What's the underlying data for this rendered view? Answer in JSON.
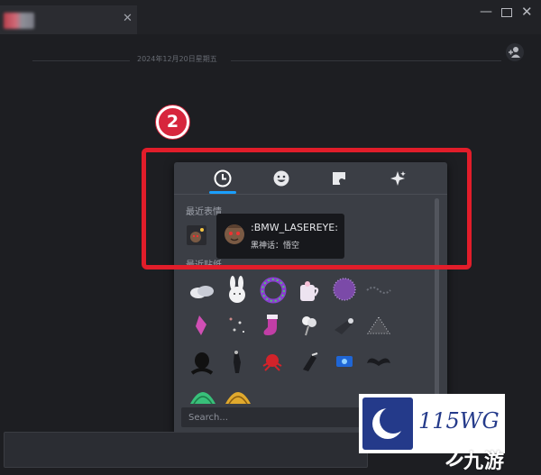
{
  "titlebar": {
    "tab_close_glyph": "✕",
    "minimize_glyph": "—",
    "close_glyph": "✕"
  },
  "chat": {
    "date_separator": "2024年12月20日星期五"
  },
  "step_badge": "2",
  "picker": {
    "tabs": [
      {
        "name": "recent",
        "icon": "clock-icon",
        "active": true
      },
      {
        "name": "emoticons",
        "icon": "smiley-icon",
        "active": false
      },
      {
        "name": "stickers",
        "icon": "sticker-icon",
        "active": false
      },
      {
        "name": "effects",
        "icon": "sparkles-icon",
        "active": false
      }
    ],
    "recent_emoticons_title": "最近表情",
    "recent_stickers_title": "最近贴纸",
    "search_placeholder": "Search...",
    "accent_color": "#1a9fff"
  },
  "tooltip": {
    "emote_name": ":BMW_LASEREYE:",
    "source_game": "黑神话：悟空"
  },
  "highlight_color": "#e11d2a",
  "watermark": {
    "logo_text": "115WG",
    "brand_text": "九游"
  }
}
